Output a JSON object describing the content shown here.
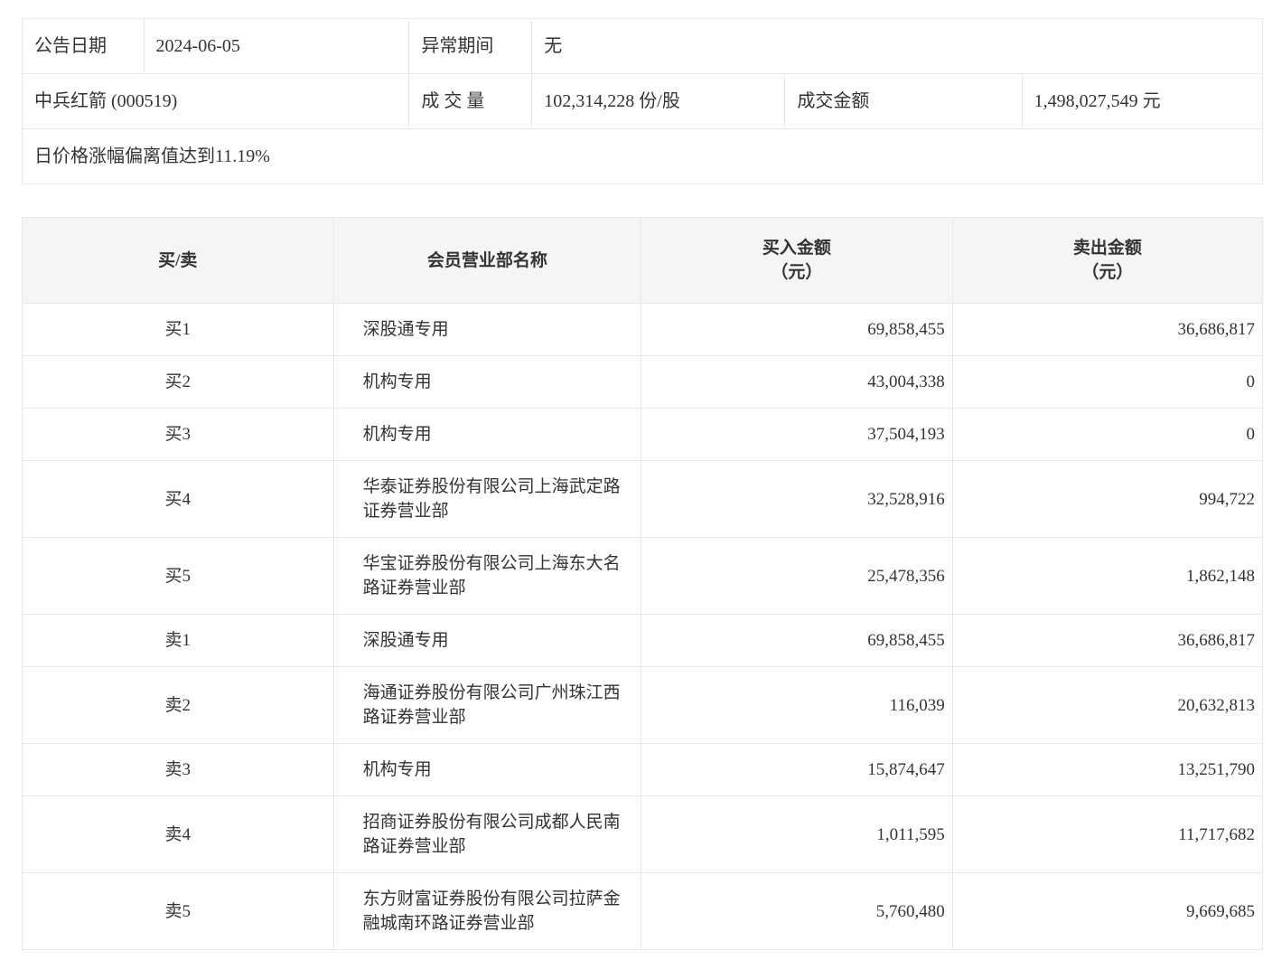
{
  "info": {
    "announce_date_label": "公告日期",
    "announce_date": "2024-06-05",
    "abnormal_period_label": "异常期间",
    "abnormal_period": "无",
    "stock_name": "中兵红箭 (000519)",
    "volume_label": "成 交 量",
    "volume": "102,314,228 份/股",
    "turnover_label": "成交金额",
    "turnover": "1,498,027,549 元",
    "deviation_note": "日价格涨幅偏离值达到11.19%"
  },
  "table": {
    "headers": {
      "side": "买/卖",
      "broker": "会员营业部名称",
      "buy": "买入金额\n（元）",
      "sell": "卖出金额\n（元）"
    },
    "rows": [
      {
        "side": "买1",
        "broker": "深股通专用",
        "buy": "69,858,455",
        "sell": "36,686,817"
      },
      {
        "side": "买2",
        "broker": "机构专用",
        "buy": "43,004,338",
        "sell": "0"
      },
      {
        "side": "买3",
        "broker": "机构专用",
        "buy": "37,504,193",
        "sell": "0"
      },
      {
        "side": "买4",
        "broker": "华泰证券股份有限公司上海武定路证券营业部",
        "buy": "32,528,916",
        "sell": "994,722"
      },
      {
        "side": "买5",
        "broker": "华宝证券股份有限公司上海东大名路证券营业部",
        "buy": "25,478,356",
        "sell": "1,862,148"
      },
      {
        "side": "卖1",
        "broker": "深股通专用",
        "buy": "69,858,455",
        "sell": "36,686,817"
      },
      {
        "side": "卖2",
        "broker": "海通证券股份有限公司广州珠江西路证券营业部",
        "buy": "116,039",
        "sell": "20,632,813"
      },
      {
        "side": "卖3",
        "broker": "机构专用",
        "buy": "15,874,647",
        "sell": "13,251,790"
      },
      {
        "side": "卖4",
        "broker": "招商证券股份有限公司成都人民南路证券营业部",
        "buy": "1,011,595",
        "sell": "11,717,682"
      },
      {
        "side": "卖5",
        "broker": "东方财富证券股份有限公司拉萨金融城南环路证券营业部",
        "buy": "5,760,480",
        "sell": "9,669,685"
      }
    ]
  }
}
